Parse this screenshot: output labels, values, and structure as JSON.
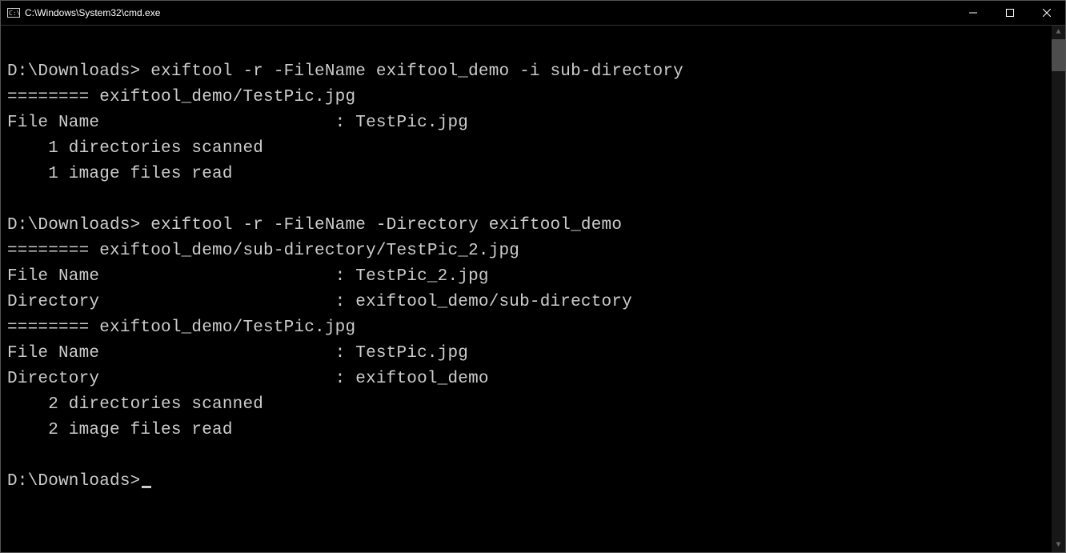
{
  "window": {
    "title": "C:\\Windows\\System32\\cmd.exe"
  },
  "terminal": {
    "lines": [
      "",
      "D:\\Downloads> exiftool -r -FileName exiftool_demo -i sub-directory",
      "======== exiftool_demo/TestPic.jpg",
      "File Name                       : TestPic.jpg",
      "    1 directories scanned",
      "    1 image files read",
      "",
      "D:\\Downloads> exiftool -r -FileName -Directory exiftool_demo",
      "======== exiftool_demo/sub-directory/TestPic_2.jpg",
      "File Name                       : TestPic_2.jpg",
      "Directory                       : exiftool_demo/sub-directory",
      "======== exiftool_demo/TestPic.jpg",
      "File Name                       : TestPic.jpg",
      "Directory                       : exiftool_demo",
      "    2 directories scanned",
      "    2 image files read",
      ""
    ],
    "prompt": "D:\\Downloads>"
  }
}
